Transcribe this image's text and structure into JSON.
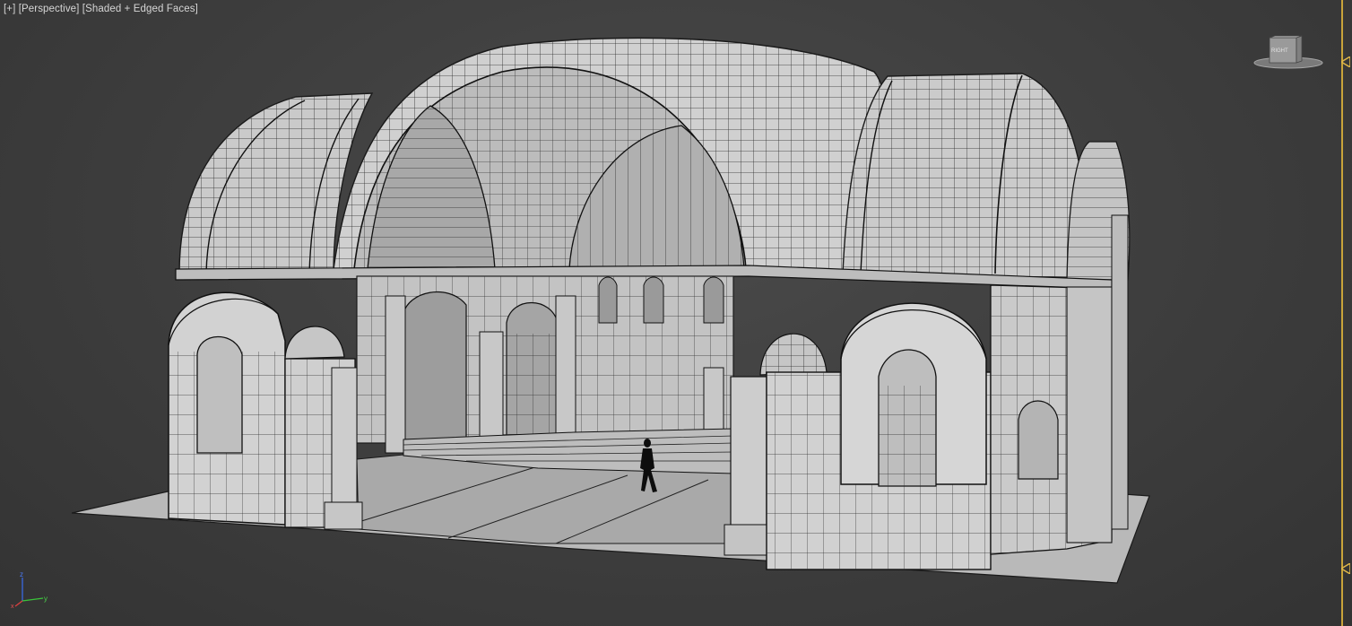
{
  "viewport": {
    "menu_plus": "[+]",
    "view_mode": "[Perspective]",
    "shading_mode": "[Shaded + Edged Faces]"
  },
  "viewcube": {
    "face_label": "RIGHT"
  },
  "axis_gizmo": {
    "x_label": "x",
    "y_label": "y",
    "z_label": "z"
  },
  "colors": {
    "background": "#3d3d3d",
    "model_face": "#d4d4d4",
    "model_edge": "#1a1a1a",
    "timeline_accent": "#c9a43a"
  }
}
